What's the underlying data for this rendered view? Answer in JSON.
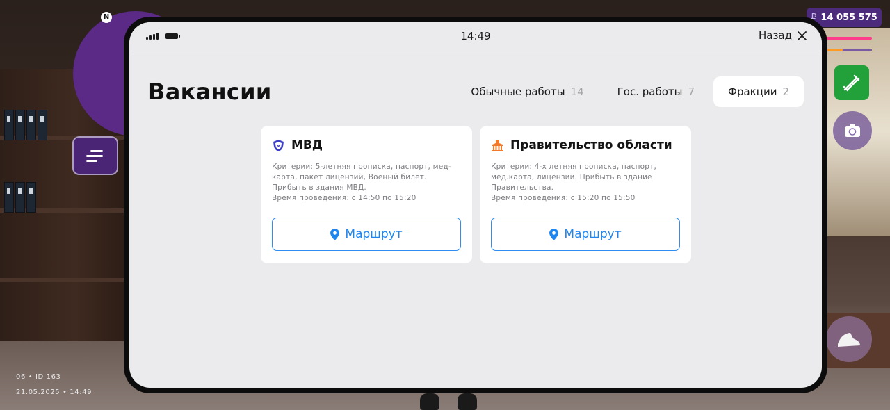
{
  "hud": {
    "compass_letter": "N",
    "money_symbol": "₽",
    "money_value": "14 055 575",
    "id_line": "06 • ID 163",
    "datetime_line": "21.05.2025 • 14:49",
    "health_level": 1.0,
    "armor_level": 0.4
  },
  "status_bar": {
    "time": "14:49",
    "back_label": "Назад"
  },
  "page": {
    "title": "Вакансии"
  },
  "tabs": [
    {
      "label": "Обычные работы",
      "count": "14",
      "active": false
    },
    {
      "label": "Гос. работы",
      "count": "7",
      "active": false
    },
    {
      "label": "Фракции",
      "count": "2",
      "active": true
    }
  ],
  "cards": [
    {
      "icon": "police-shield-icon",
      "title": "МВД",
      "criteria": "Критерии:  5-летняя прописка, паспорт, мед-карта, пакет лицензий, Военый билет. Прибыть в здания МВД.",
      "time": "Время проведения: с 14:50 по 15:20",
      "button_label": "Маршрут"
    },
    {
      "icon": "government-building-icon",
      "title": "Правительство области",
      "criteria": "Критерии: 4-х летняя прописка, паспорт, мед.карта, лицензии. Прибыть в здание Правительства.",
      "time": "Время проведения: с 15:20 по 15:50",
      "button_label": "Маршрут"
    }
  ],
  "colors": {
    "accent_blue": "#1f86f0",
    "hud_purple": "#4c2a7c",
    "weapon_green": "#22a13a",
    "health_pink": "#ff3c8c",
    "armor_orange": "#ff9a22"
  }
}
